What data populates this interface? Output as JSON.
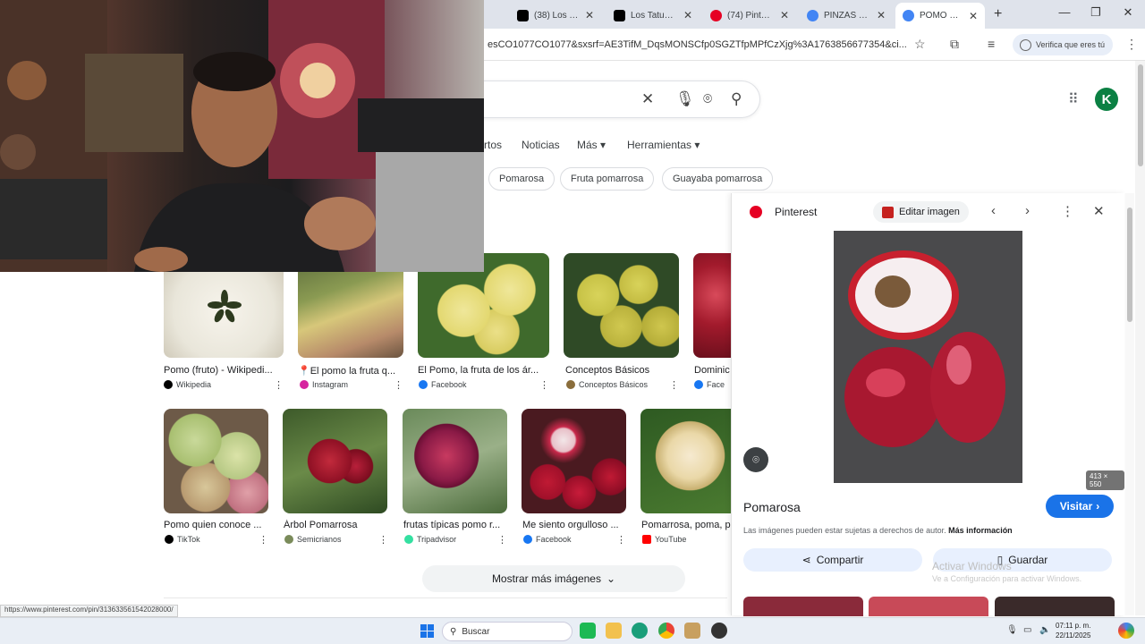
{
  "browser": {
    "tabs": [
      {
        "label": "(38) Los Tatuad",
        "icon": "tiktok-icon",
        "color": "#000000"
      },
      {
        "label": "Los Tatuadores",
        "icon": "tiktok-icon",
        "color": "#000000"
      },
      {
        "label": "(74) Pinterest",
        "icon": "pinterest-icon",
        "color": "#e60023"
      },
      {
        "label": "PINZAS PARA",
        "icon": "google-icon",
        "color": "#4285f4"
      },
      {
        "label": "POMO FRUTA",
        "icon": "google-icon",
        "color": "#4285f4",
        "active": true
      }
    ],
    "new_tab": "+",
    "url": "esCO1077CO1077&sxsrf=AE3TifM_DqsMONSCfp0SGZTfpMPfCzXjg%3A1763856677354&ci...",
    "verify_label": "Verifica que eres tú"
  },
  "search": {
    "nav_tabs": [
      "rtos",
      "Noticias",
      "Más",
      "Herramientas"
    ],
    "chips": [
      "Pomarosa",
      "Fruta pomarrosa",
      "Guayaba pomarrosa"
    ]
  },
  "results": {
    "row1": [
      {
        "caption": "Pomo (fruto) - Wikipedi...",
        "source": "Wikipedia",
        "src_color": "#000000"
      },
      {
        "caption": "📍El pomo la fruta q...",
        "source": "Instagram",
        "src_color": "#d6249f"
      },
      {
        "caption": "El Pomo, la fruta de los ár...",
        "source": "Facebook",
        "src_color": "#1877f2"
      },
      {
        "caption": "Conceptos Básicos",
        "source": "Conceptos Básicos",
        "src_color": "#8a6d3b"
      },
      {
        "caption": "Dominic",
        "source": "Face",
        "src_color": "#1877f2"
      }
    ],
    "row2": [
      {
        "caption": "Pomo quien conoce ...",
        "source": "TikTok",
        "src_color": "#000000"
      },
      {
        "caption": "Árbol Pomarrosa",
        "source": "Semicrianos",
        "src_color": "#7a8b5a"
      },
      {
        "caption": "frutas típicas pomo r...",
        "source": "Tripadvisor",
        "src_color": "#34e0a1"
      },
      {
        "caption": "Me siento orgulloso ...",
        "source": "Facebook",
        "src_color": "#1877f2"
      },
      {
        "caption": "Pomarrosa, poma, p",
        "source": "YouTube",
        "src_color": "#ff0000"
      }
    ],
    "more_label": "Mostrar más imágenes"
  },
  "panel": {
    "source": "Pinterest",
    "edit_label": "Editar imagen",
    "dimensions": "413 × 550",
    "title": "Pomarosa",
    "visit_label": "Visitar",
    "copyright": "Las imágenes pueden estar sujetas a derechos de autor.",
    "more_info": "Más información",
    "share_label": "Compartir",
    "save_label": "Guardar"
  },
  "windows_watermark": {
    "line1": "Activar Windows",
    "line2": "Ve a Configuración para activar Windows."
  },
  "status_url": "https://www.pinterest.com/pin/313633561542028000/",
  "taskbar": {
    "search_label": "Buscar",
    "time": "07:11 p. m.",
    "date": "22/11/2025"
  }
}
